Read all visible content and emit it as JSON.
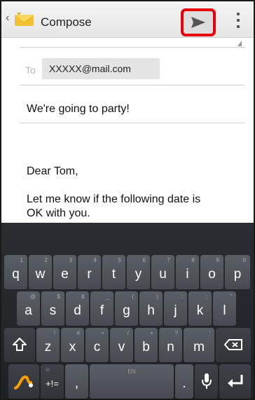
{
  "action_bar": {
    "title": "Compose",
    "up_icon": "chevron-left-icon",
    "app_icon": "envelope-icon",
    "send_icon": "send-icon",
    "overflow_icon": "more-vertical-icon",
    "highlight_color": "#e8000b"
  },
  "compose": {
    "to_label": "To",
    "to_recipient": "XXXXX@mail.com",
    "subject": "We're going to party!",
    "body_lines": [
      "Dear Tom,",
      "",
      "Let me know if the following date is",
      "OK with you."
    ]
  },
  "keyboard": {
    "row1": [
      {
        "key": "q",
        "alt": "1"
      },
      {
        "key": "w",
        "alt": "2"
      },
      {
        "key": "e",
        "alt": "3"
      },
      {
        "key": "r",
        "alt": "4"
      },
      {
        "key": "t",
        "alt": "5"
      },
      {
        "key": "y",
        "alt": "6"
      },
      {
        "key": "u",
        "alt": "7"
      },
      {
        "key": "i",
        "alt": "8"
      },
      {
        "key": "o",
        "alt": "9"
      },
      {
        "key": "p",
        "alt": "0"
      }
    ],
    "row2": [
      {
        "key": "a",
        "alt": "@"
      },
      {
        "key": "s",
        "alt": "$"
      },
      {
        "key": "d",
        "alt": "&"
      },
      {
        "key": "f",
        "alt": "_"
      },
      {
        "key": "g",
        "alt": "("
      },
      {
        "key": "h",
        "alt": ")"
      },
      {
        "key": "j",
        "alt": ":"
      },
      {
        "key": "k",
        "alt": ";"
      },
      {
        "key": "l",
        "alt": "\""
      }
    ],
    "row3": [
      {
        "key": "z",
        "alt": "!"
      },
      {
        "key": "x",
        "alt": "#"
      },
      {
        "key": "c",
        "alt": "="
      },
      {
        "key": "v",
        "alt": "/"
      },
      {
        "key": "b",
        "alt": "+"
      },
      {
        "key": "n",
        "alt": "?"
      },
      {
        "key": "m",
        "alt": "'"
      }
    ],
    "symbols_label": "+!=",
    "symbols_alt": "☺",
    "comma_label": ",",
    "period_label": ".",
    "space_label": "EN",
    "shift_icon": "shift-icon",
    "backspace_icon": "backspace-icon",
    "swype_icon": "swype-logo-icon",
    "mic_icon": "microphone-icon",
    "enter_icon": "enter-icon"
  }
}
